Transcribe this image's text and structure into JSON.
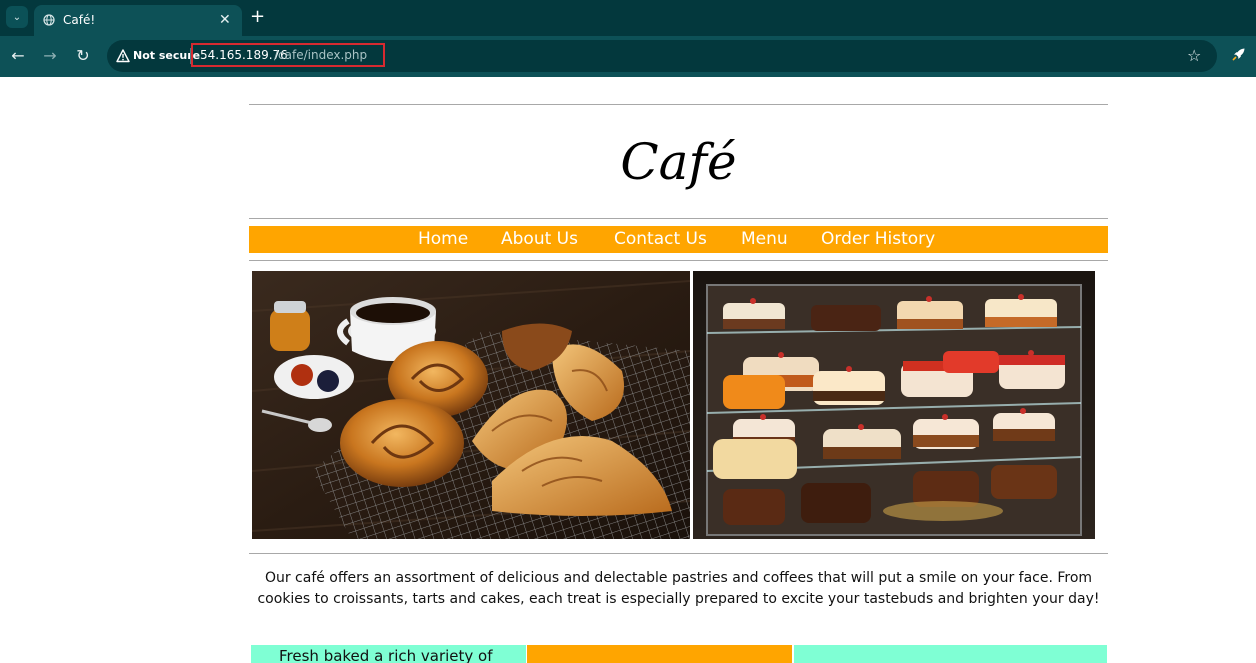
{
  "browser": {
    "tab_title": "Café!",
    "tab_close": "✕",
    "new_tab": "+",
    "back": "←",
    "forward": "→",
    "reload": "↻",
    "security_label": "Not secure",
    "url_host": "54.165.189.76",
    "url_path": "/cafe/index.php",
    "bookmark_icon": "☆",
    "tab_search_icon": "⌄"
  },
  "page": {
    "title": "Café",
    "nav": [
      "Home",
      "About Us",
      "Contact Us",
      "Menu",
      "Order History"
    ],
    "intro": "Our café offers an assortment of delicious and delectable pastries and coffees that will put a smile on your face. From cookies to croissants, tarts and cakes, each treat is especially prepared to excite your tastebuds and brighten your day!",
    "feature_text": "Fresh baked a rich variety of"
  },
  "colors": {
    "nav_bg": "#ffa500",
    "panel_aqua": "#7fffd4",
    "chrome_dark": "#03383d",
    "chrome": "#0d5157",
    "url_highlight": "#d62a30"
  }
}
